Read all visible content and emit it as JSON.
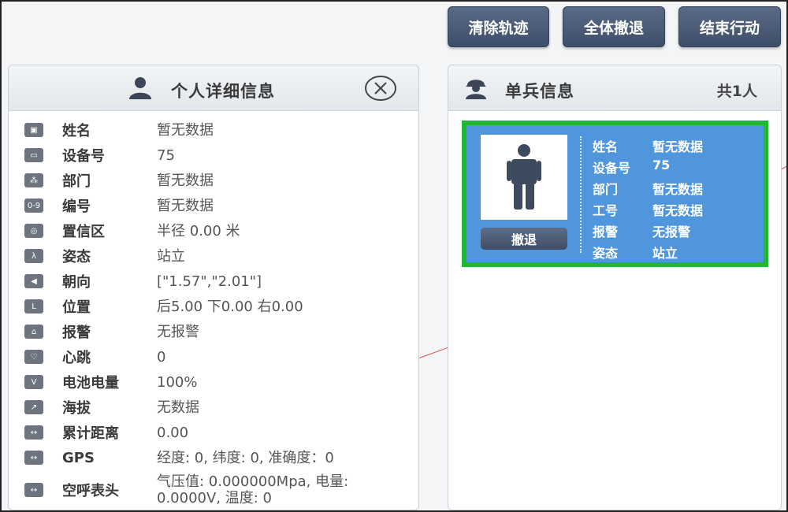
{
  "toolbar": {
    "clear_track": "清除轨迹",
    "retreat_all": "全体撤退",
    "end_action": "结束行动"
  },
  "detail_panel": {
    "title": "个人详细信息",
    "rows": [
      {
        "icon": "id-card-icon",
        "label": "姓名",
        "value": "暂无数据"
      },
      {
        "icon": "device-icon",
        "label": "设备号",
        "value": "75"
      },
      {
        "icon": "department-icon",
        "label": "部门",
        "value": "暂无数据"
      },
      {
        "icon": "number-icon",
        "label": "编号",
        "value": "暂无数据",
        "glyph": "0-9"
      },
      {
        "icon": "target-icon",
        "label": "置信区",
        "value": "半径 0.00 米"
      },
      {
        "icon": "posture-icon",
        "label": "姿态",
        "value": "站立"
      },
      {
        "icon": "direction-icon",
        "label": "朝向",
        "value": "[\"1.57\",\"2.01\"]"
      },
      {
        "icon": "position-icon",
        "label": "位置",
        "value": "后5.00 下0.00 右0.00"
      },
      {
        "icon": "alarm-icon",
        "label": "报警",
        "value": "无报警"
      },
      {
        "icon": "heart-icon",
        "label": "心跳",
        "value": "0"
      },
      {
        "icon": "battery-icon",
        "label": "电池电量",
        "value": "100%",
        "glyph": "V"
      },
      {
        "icon": "altitude-icon",
        "label": "海拔",
        "value": "无数据"
      },
      {
        "icon": "distance-icon",
        "label": "累计距离",
        "value": "0.00"
      },
      {
        "icon": "gps-icon",
        "label": "GPS",
        "value": "经度: 0, 纬度: 0, 准确度：0"
      },
      {
        "icon": "respirator-icon",
        "label": "空呼表头",
        "value": "气压值: 0.000000Mpa, 电量: 0.0000V, 温度: 0"
      }
    ]
  },
  "soldier_panel": {
    "title": "单兵信息",
    "count": "共1人",
    "card": {
      "retreat_label": "撤退",
      "fields": [
        {
          "label": "姓名",
          "value": "暂无数据"
        },
        {
          "label": "设备号",
          "value": "75"
        },
        {
          "label": "部门",
          "value": "暂无数据"
        },
        {
          "label": "工号",
          "value": "暂无数据"
        },
        {
          "label": "报警",
          "value": "无报警"
        },
        {
          "label": "姿态",
          "value": "站立"
        }
      ]
    }
  },
  "colors": {
    "card_bg": "#4f96dc",
    "card_border": "#20b830",
    "button_bg": "#46546f"
  }
}
